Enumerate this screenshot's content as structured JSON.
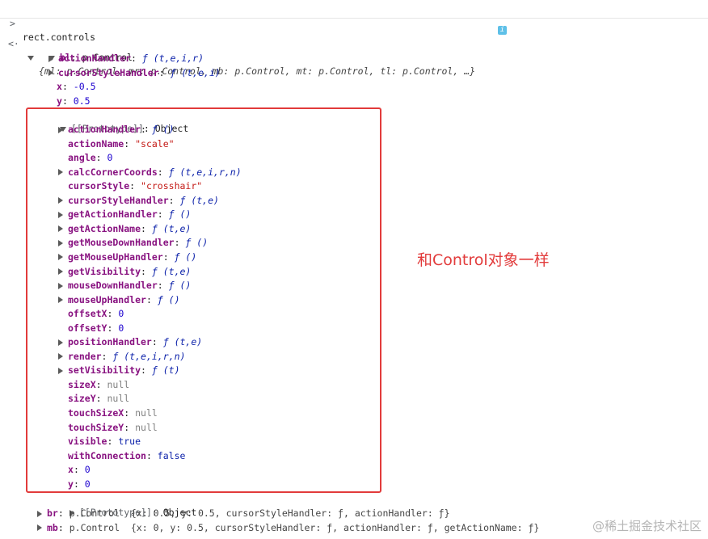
{
  "console": {
    "input": "rect.controls",
    "prompt_symbol": ">",
    "result_symbol": "<·",
    "summary": "{ml: p.Control, mr: p.Control, mb: p.Control, mt: p.Control, tl: p.Control, …}",
    "info_badge": "i",
    "bl": {
      "key": "bl",
      "type": "p.Control",
      "own": [
        {
          "key": "actionHandler",
          "value": "ƒ (t,e,i,r)",
          "kind": "fn",
          "expandable": true
        },
        {
          "key": "cursorStyleHandler",
          "value": "ƒ (t,e,i)",
          "kind": "fn",
          "expandable": true
        },
        {
          "key": "x",
          "value": "-0.5",
          "kind": "num",
          "expandable": false
        },
        {
          "key": "y",
          "value": "0.5",
          "kind": "num",
          "expandable": false
        }
      ],
      "prototype": {
        "label": "[[Prototype]]",
        "type": "Object",
        "props": [
          {
            "key": "actionHandler",
            "value": "ƒ ()",
            "kind": "fn",
            "expandable": true
          },
          {
            "key": "actionName",
            "value": "\"scale\"",
            "kind": "str",
            "expandable": false
          },
          {
            "key": "angle",
            "value": "0",
            "kind": "num",
            "expandable": false
          },
          {
            "key": "calcCornerCoords",
            "value": "ƒ (t,e,i,r,n)",
            "kind": "fn",
            "expandable": true
          },
          {
            "key": "cursorStyle",
            "value": "\"crosshair\"",
            "kind": "str",
            "expandable": false
          },
          {
            "key": "cursorStyleHandler",
            "value": "ƒ (t,e)",
            "kind": "fn",
            "expandable": true
          },
          {
            "key": "getActionHandler",
            "value": "ƒ ()",
            "kind": "fn",
            "expandable": true
          },
          {
            "key": "getActionName",
            "value": "ƒ (t,e)",
            "kind": "fn",
            "expandable": true
          },
          {
            "key": "getMouseDownHandler",
            "value": "ƒ ()",
            "kind": "fn",
            "expandable": true
          },
          {
            "key": "getMouseUpHandler",
            "value": "ƒ ()",
            "kind": "fn",
            "expandable": true
          },
          {
            "key": "getVisibility",
            "value": "ƒ (t,e)",
            "kind": "fn",
            "expandable": true
          },
          {
            "key": "mouseDownHandler",
            "value": "ƒ ()",
            "kind": "fn",
            "expandable": true
          },
          {
            "key": "mouseUpHandler",
            "value": "ƒ ()",
            "kind": "fn",
            "expandable": true
          },
          {
            "key": "offsetX",
            "value": "0",
            "kind": "num",
            "expandable": false
          },
          {
            "key": "offsetY",
            "value": "0",
            "kind": "num",
            "expandable": false
          },
          {
            "key": "positionHandler",
            "value": "ƒ (t,e)",
            "kind": "fn",
            "expandable": true
          },
          {
            "key": "render",
            "value": "ƒ (t,e,i,r,n)",
            "kind": "fn",
            "expandable": true
          },
          {
            "key": "setVisibility",
            "value": "ƒ (t)",
            "kind": "fn",
            "expandable": true
          },
          {
            "key": "sizeX",
            "value": "null",
            "kind": "nul",
            "expandable": false
          },
          {
            "key": "sizeY",
            "value": "null",
            "kind": "nul",
            "expandable": false
          },
          {
            "key": "touchSizeX",
            "value": "null",
            "kind": "nul",
            "expandable": false
          },
          {
            "key": "touchSizeY",
            "value": "null",
            "kind": "nul",
            "expandable": false
          },
          {
            "key": "visible",
            "value": "true",
            "kind": "bool",
            "expandable": false
          },
          {
            "key": "withConnection",
            "value": "false",
            "kind": "bool",
            "expandable": false
          },
          {
            "key": "x",
            "value": "0",
            "kind": "num",
            "expandable": false
          },
          {
            "key": "y",
            "value": "0",
            "kind": "num",
            "expandable": false
          }
        ],
        "nested_proto_label": "[[Prototype]]",
        "nested_proto_type": "Object"
      }
    },
    "after": [
      {
        "key": "br",
        "summary": "p.Control  {x: 0.5, y: 0.5, cursorStyleHandler: ƒ, actionHandler: ƒ}"
      },
      {
        "key": "mb",
        "summary": "p.Control  {x: 0, y: 0.5, cursorStyleHandler: ƒ, actionHandler: ƒ, getActionName: ƒ}"
      }
    ]
  },
  "annotation": "和Control对象一样",
  "watermark": "@稀土掘金技术社区"
}
